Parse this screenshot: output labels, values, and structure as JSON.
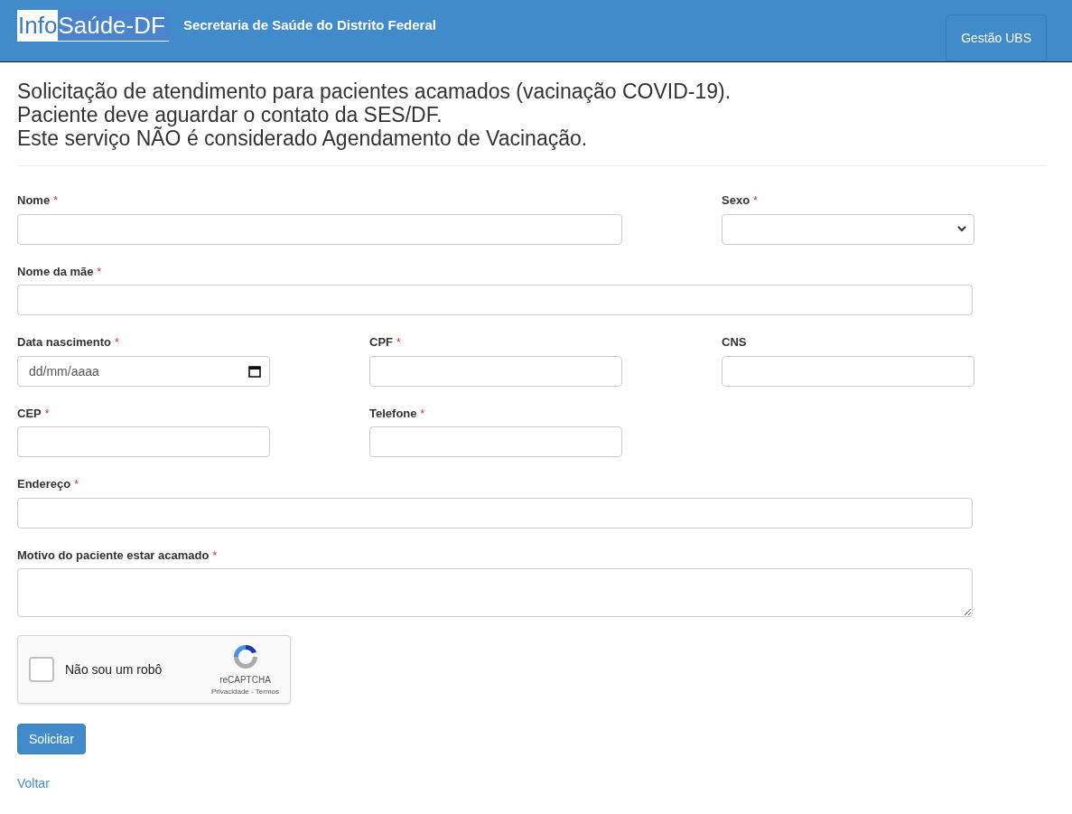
{
  "header": {
    "logo": {
      "part_1": "Info",
      "part_2": "Saúde-DF"
    },
    "title": "Secretaria de Saúde do Distrito Federal",
    "nav_button": "Gestão UBS"
  },
  "heading_lines": [
    "Solicitação de atendimento para pacientes acamados (vacinação COVID-19).",
    "Paciente deve aguardar o contato da SES/DF.",
    "Este serviço NÃO é considerado Agendamento de Vacinação."
  ],
  "required_mark": "*",
  "form_rows": [
    [
      {
        "label": "Nome",
        "required": true,
        "kind": "text"
      },
      {
        "label": "Sexo",
        "required": true,
        "kind": "select"
      }
    ],
    [
      {
        "label": "Nome da mãe",
        "required": true,
        "kind": "text"
      }
    ],
    [
      {
        "label": "Data nascimento",
        "required": true,
        "kind": "date",
        "placeholder": "dd/mm/aaaa"
      },
      {
        "label": "CPF",
        "required": true,
        "kind": "text"
      },
      {
        "label": "CNS",
        "required": false,
        "kind": "text"
      }
    ],
    [
      {
        "label": "CEP",
        "required": true,
        "kind": "text"
      },
      {
        "label": "Telefone",
        "required": true,
        "kind": "text"
      }
    ],
    [
      {
        "label": "Endereço",
        "required": true,
        "kind": "text"
      }
    ],
    [
      {
        "label": "Motivo do paciente estar acamado",
        "required": true,
        "kind": "textarea"
      }
    ]
  ],
  "captcha": {
    "label": "Não sou um robô",
    "checked": false,
    "brand": "reCAPTCHA",
    "links": "Privacidade - Termos"
  },
  "submit_button": "Solicitar",
  "back_link": "Voltar"
}
